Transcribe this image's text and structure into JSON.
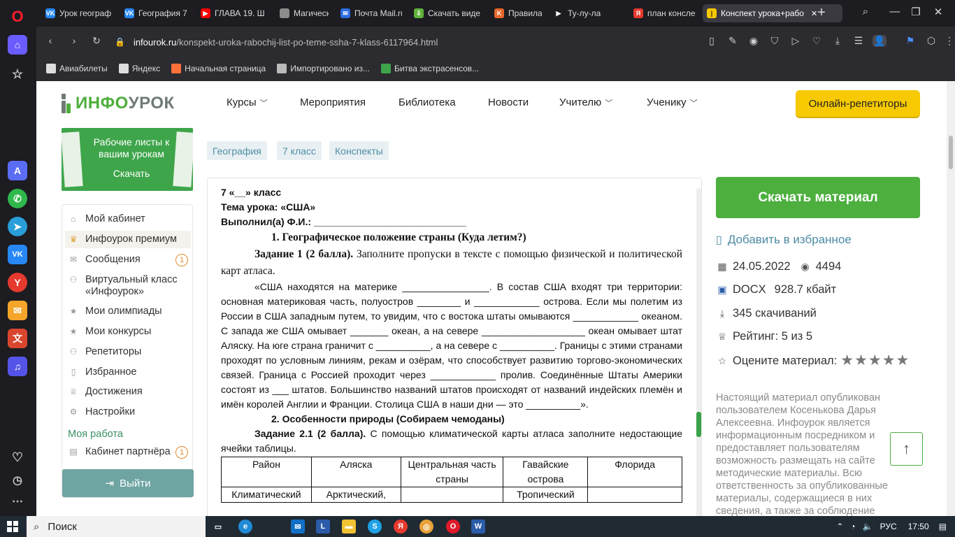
{
  "browser": {
    "tabs": [
      {
        "label": "Урок географ",
        "icon": "vk-icon",
        "color": "#2787f5",
        "glyph": "VK"
      },
      {
        "label": "География 7",
        "icon": "vk-icon",
        "color": "#2787f5",
        "glyph": "VK"
      },
      {
        "label": "ГЛАВА 19. Ш",
        "icon": "youtube-icon",
        "color": "#ff0000",
        "glyph": "▶"
      },
      {
        "label": "Магическая",
        "icon": "page-icon",
        "color": "#8d8d8d",
        "glyph": ""
      },
      {
        "label": "Почта Mail.ru",
        "icon": "mail-icon",
        "color": "#2d6cdf",
        "glyph": "✉"
      },
      {
        "label": "Скачать виде",
        "icon": "download-icon",
        "color": "#61b33b",
        "glyph": "⇩"
      },
      {
        "label": "Правила стр",
        "icon": "site-icon",
        "color": "#e8672a",
        "glyph": "K"
      },
      {
        "label": "Ту-лу-ла",
        "icon": "audio-icon",
        "color": "#ffffff",
        "glyph": "▶"
      },
      {
        "label": "план консле",
        "icon": "yandex-icon",
        "color": "#e63a2e",
        "glyph": "Я"
      },
      {
        "label": "Конспект урока+рабо",
        "icon": "infourok-icon",
        "color": "#f7c900",
        "glyph": "|"
      }
    ],
    "url_domain": "infourok.ru",
    "url_path": "/konspekt-uroka-rabochij-list-po-teme-ssha-7-klass-6117964.html",
    "bookmarks": [
      {
        "label": "Авиабилеты",
        "color": "#ddd"
      },
      {
        "label": "Яндекс",
        "color": "#ddd"
      },
      {
        "label": "Начальная страница",
        "color": "#ff7139"
      },
      {
        "label": "Импортировано из...",
        "color": "#bbb"
      },
      {
        "label": "Битва экстрасенсов...",
        "color": "#3ea44a"
      }
    ]
  },
  "site": {
    "logo_part1": "ИНФО",
    "logo_part2": "УРОК",
    "nav": [
      "Курсы",
      "Мероприятия",
      "Библиотека",
      "Новости",
      "Учителю",
      "Ученику"
    ],
    "tutor_button": "Онлайн-репетиторы"
  },
  "banner": {
    "text": "Рабочие листы к вашим урокам",
    "button": "Скачать"
  },
  "user_menu": {
    "items": [
      {
        "label": "Мой кабинет",
        "icon": "home-icon"
      },
      {
        "label": "Инфоурок премиум",
        "icon": "crown-icon"
      },
      {
        "label": "Сообщения",
        "icon": "envelope-icon",
        "badge": "1"
      },
      {
        "label": "Виртуальный класс «Инфоурок»",
        "icon": "group-icon"
      },
      {
        "label": "Мои олимпиады",
        "icon": "star-icon"
      },
      {
        "label": "Мои конкурсы",
        "icon": "star-icon"
      },
      {
        "label": "Репетиторы",
        "icon": "people-icon"
      },
      {
        "label": "Избранное",
        "icon": "bookmark-icon"
      },
      {
        "label": "Достижения",
        "icon": "trophy-icon"
      },
      {
        "label": "Настройки",
        "icon": "gear-icon"
      }
    ],
    "section": "Моя работа",
    "partner": {
      "label": "Кабинет партнёра",
      "badge": "1"
    },
    "logout": "Выйти"
  },
  "tags": [
    "География",
    "7 класс",
    "Конспекты"
  ],
  "document": {
    "line1": "7 «__» класс",
    "line2": "Тема урока: «США»",
    "line3": "Выполнил(а) Ф.И.: ____________________________",
    "h1": "1.    Географическое положение страны (Куда летим?)",
    "task1_label": "Задание 1 (2 балла).",
    "task1_text": " Заполните пропуски в тексте с помощью физической и политической карт атласа.",
    "para1": "«США находятся на материке ________________. В состав США входят три территории: основная материковая часть, полуостров ________ и ____________ острова. Если мы полетим из России в США западным путем, то увидим, что с востока штаты омываются ____________ океаном. С запада же США омывает _______ океан, а на севере ___________________ океан омывает штат Аляску. На юге страна граничит с __________, а на севере с __________. Границы с этими странами проходят по условным линиям, рекам и озёрам, что способствует развитию торгово-экономических связей. Граница с Россией проходит через ____________ пролив. Соединённые Штаты Америки состоят из ___  штатов. Большинство названий штатов происходят от названий индейских племён и имён королей Англии и Франции. Столица США в наши дни — это __________».",
    "h2": "2.    Особенности природы (Собираем чемоданы)",
    "task2_label": "Задание 2.1 (2 балла).",
    "task2_text": " С помощью климатической карты атласа заполните недостающие ячейки таблицы.",
    "table_header": [
      "Район",
      "Аляска",
      "Центральная часть страны",
      "Гавайские острова",
      "Флорида"
    ],
    "table_row1": [
      "Климатический",
      "Арктический,",
      "",
      "Тропический",
      ""
    ]
  },
  "sidebar_right": {
    "download": "Скачать материал",
    "favorite": "Добавить в избранное",
    "date": "24.05.2022",
    "views": "4494",
    "format": "DOCX",
    "size": "928.7 кбайт",
    "downloads": "345 скачиваний",
    "rating": "Рейтинг: 5 из 5",
    "rate_label": "Оцените материал:",
    "disclaimer": "Настоящий материал опубликован пользователем Косенькова Дарья Алексеевна. Инфоурок является информационным посредником и предоставляет пользователям возможность размещать на сайте методические материалы. Всю ответственность за опубликованные материалы, содержащиеся в них сведения, а также за соблюдение"
  },
  "taskbar": {
    "search": "Поиск",
    "lang": "РУС",
    "time": "17:50"
  },
  "colors": {
    "brand_green": "#4caf3e",
    "accent_yellow": "#f7c900",
    "teal": "#6ea5a3"
  }
}
